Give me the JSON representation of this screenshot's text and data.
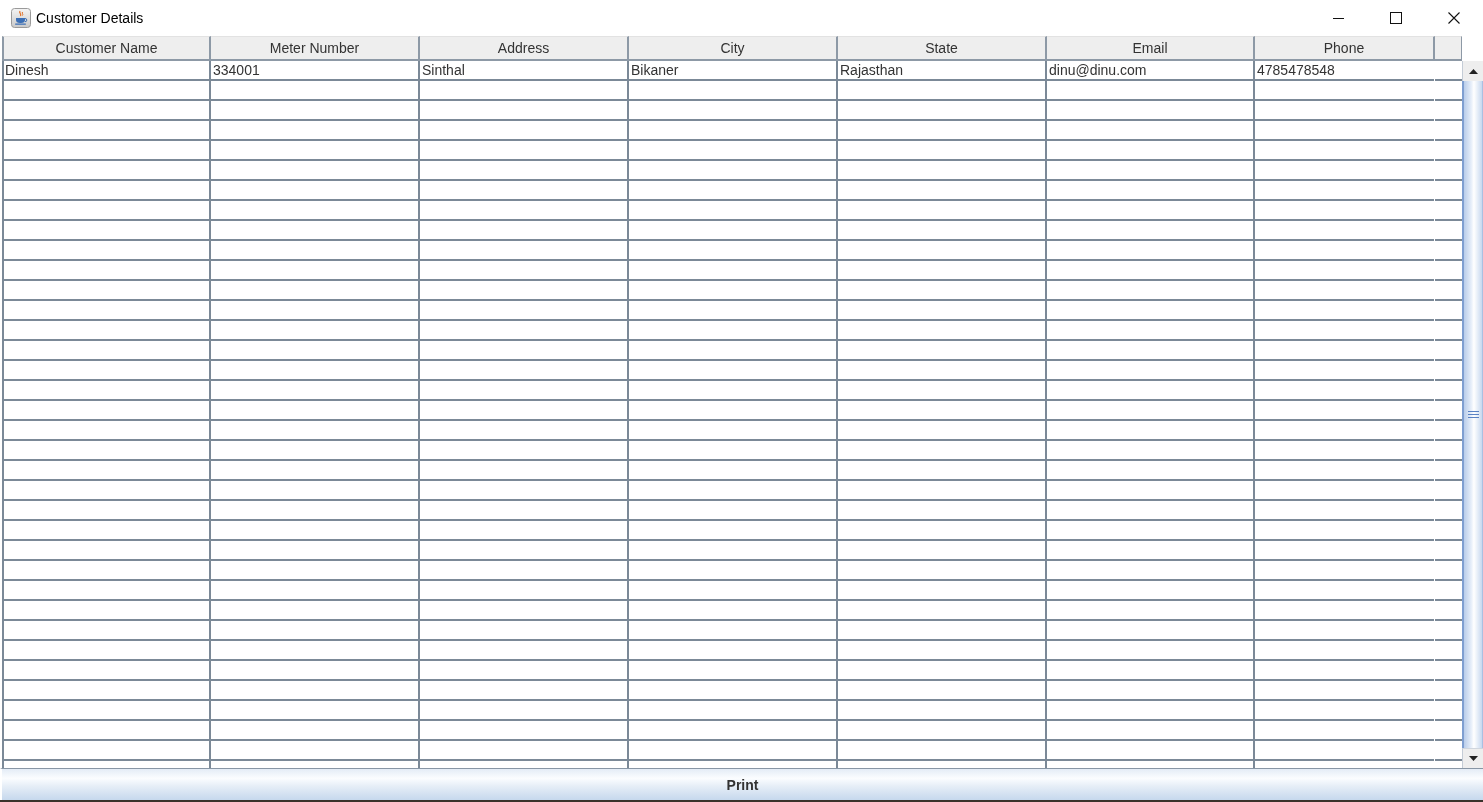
{
  "window": {
    "title": "Customer Details"
  },
  "table": {
    "columns": [
      "Customer Name",
      "Meter Number",
      "Address",
      "City",
      "State",
      "Email",
      "Phone"
    ],
    "rows": [
      [
        "Dinesh",
        "334001",
        "Sinthal",
        "Bikaner",
        "Rajasthan",
        "dinu@dinu.com",
        "4785478548"
      ]
    ]
  },
  "print_button": {
    "label": "Print"
  }
}
